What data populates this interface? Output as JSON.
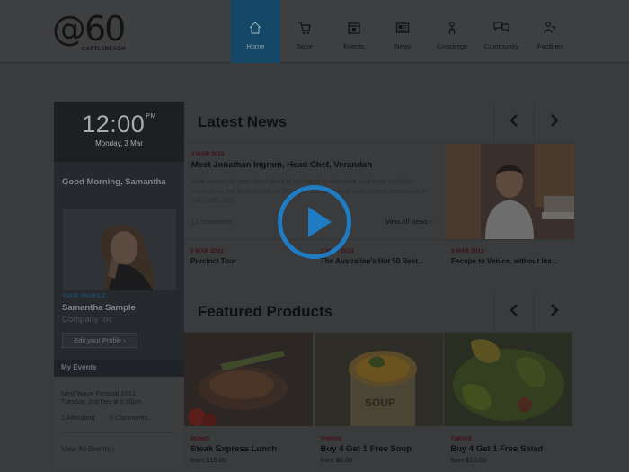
{
  "brand": {
    "logo_text": "@60",
    "logo_subtext": "CASTLEREAGH"
  },
  "nav": [
    {
      "label": "Home",
      "icon": "home-icon",
      "active": true
    },
    {
      "label": "Store",
      "icon": "cart-icon"
    },
    {
      "label": "Events",
      "icon": "calendar-icon"
    },
    {
      "label": "News",
      "icon": "newspaper-icon"
    },
    {
      "label": "Concierge",
      "icon": "concierge-icon"
    },
    {
      "label": "Community",
      "icon": "chat-bubbles-icon"
    },
    {
      "label": "Facilities",
      "icon": "facilities-icon"
    }
  ],
  "clock": {
    "time": "12:00",
    "suffix": "PM",
    "date": "Monday, 3 Mar"
  },
  "profile": {
    "greeting": "Good Morning, Samantha",
    "tag": "YOUR PROFILE",
    "name": "Samantha Sample",
    "company": "Company Inc",
    "edit_label": "Edit your Profile"
  },
  "events": {
    "header": "My Events",
    "name": "Next Wave Festival 2012",
    "date": "Tuesday, 2nd Dec at 6:30pm",
    "attending": "1 Attending",
    "comments": "0 Comments",
    "view_all": "View All Events"
  },
  "news": {
    "title": "Latest News",
    "featured": {
      "date": "3 MAR 2013",
      "title": "Meet Jonathan Ingram, Head Chef, Verandah",
      "body": "Sitat autem vel eum iriure dolor in hendrerit in vulputate velit esse molestie consequat, vel illum dolore eu feugiat nulla facilisis at vero eros et accumsan et iusto odio dign",
      "comments": "12 comments",
      "view_all": "View All News"
    },
    "items": [
      {
        "date": "3 MAR 2013",
        "title": "Precinct Tour"
      },
      {
        "date": "3 MAR 2013",
        "title": "The Australian's Hot 50 Rest..."
      },
      {
        "date": "3 MAR 2013",
        "title": "Escape to Venice, without lea..."
      }
    ]
  },
  "featured": {
    "title": "Featured Products",
    "products": [
      {
        "brand": "MOMO",
        "name": "Steak Express Lunch",
        "price": "from $15.00"
      },
      {
        "brand": "THRIVE",
        "name": "Buy 4 Get 1 Free Soup",
        "price": "from $6.00"
      },
      {
        "brand": "THRIVE",
        "name": "Buy 4 Get 1 Free Salad",
        "price": "from $10.00"
      }
    ]
  },
  "colors": {
    "overlay_play": "#1f7bc2",
    "nav_active": "#144866"
  }
}
